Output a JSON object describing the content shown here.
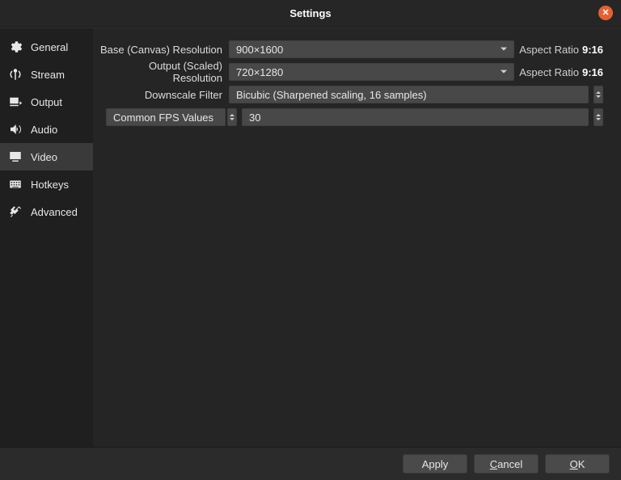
{
  "window": {
    "title": "Settings"
  },
  "sidebar": {
    "items": [
      {
        "label": "General"
      },
      {
        "label": "Stream"
      },
      {
        "label": "Output"
      },
      {
        "label": "Audio"
      },
      {
        "label": "Video"
      },
      {
        "label": "Hotkeys"
      },
      {
        "label": "Advanced"
      }
    ],
    "active_index": 4
  },
  "form": {
    "base_res_label": "Base (Canvas) Resolution",
    "base_res_value": "900×1600",
    "base_aspect_label": "Aspect Ratio",
    "base_aspect_value": "9:16",
    "output_res_label": "Output (Scaled) Resolution",
    "output_res_value": "720×1280",
    "output_aspect_label": "Aspect Ratio",
    "output_aspect_value": "9:16",
    "filter_label": "Downscale Filter",
    "filter_value": "Bicubic (Sharpened scaling, 16 samples)",
    "fps_mode_label": "Common FPS Values",
    "fps_value": "30"
  },
  "footer": {
    "apply": "Apply",
    "cancel_pre": "",
    "cancel_mn": "C",
    "cancel_post": "ancel",
    "ok_pre": "",
    "ok_mn": "O",
    "ok_post": "K"
  }
}
